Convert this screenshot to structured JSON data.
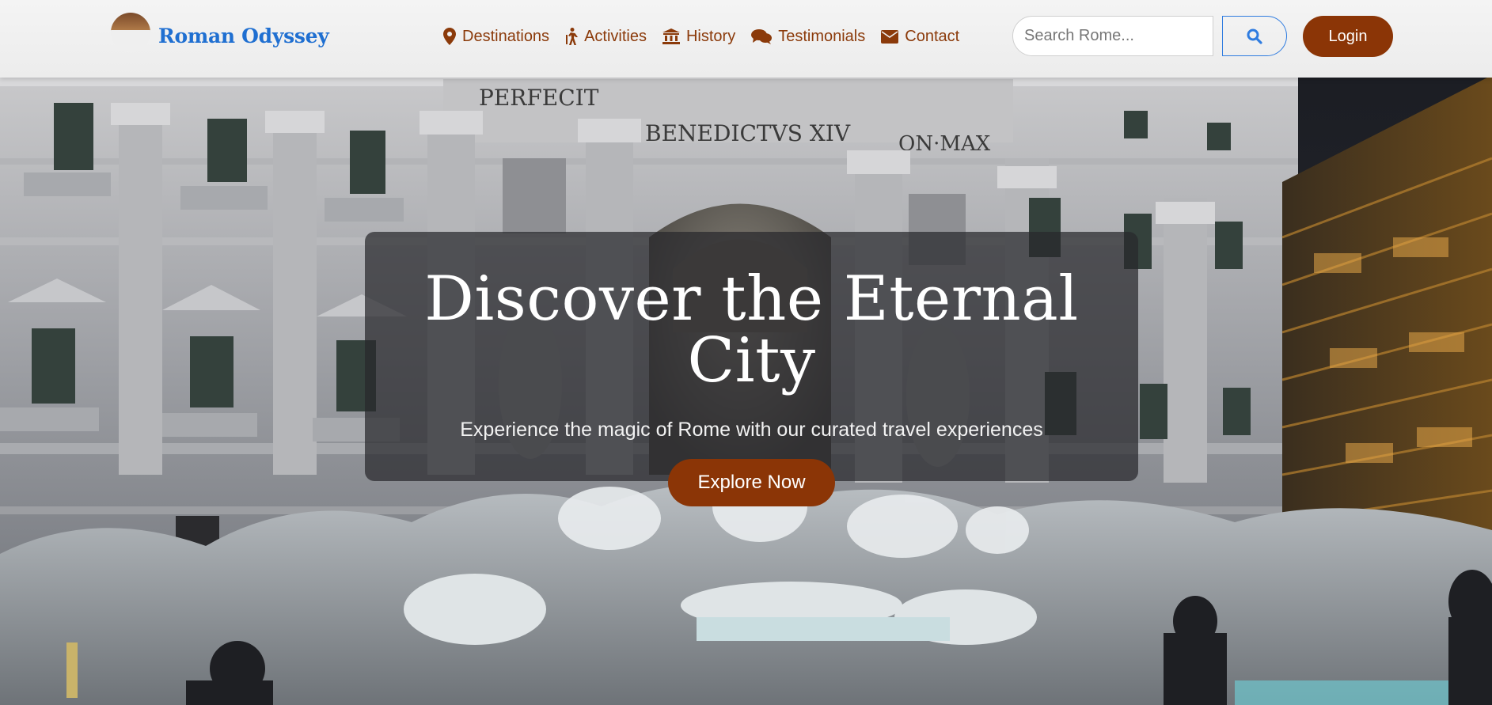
{
  "brand": {
    "name": "Roman Odyssey"
  },
  "nav": {
    "items": [
      {
        "label": "Destinations",
        "icon": "map-pin-icon"
      },
      {
        "label": "Activities",
        "icon": "hiking-icon"
      },
      {
        "label": "History",
        "icon": "landmark-icon"
      },
      {
        "label": "Testimonials",
        "icon": "comments-icon"
      },
      {
        "label": "Contact",
        "icon": "envelope-icon"
      }
    ]
  },
  "search": {
    "placeholder": "Search Rome...",
    "value": "",
    "button_icon": "search-icon"
  },
  "login": {
    "label": "Login"
  },
  "hero": {
    "title": "Discover the Eternal City",
    "subtitle": "Experience the magic of Rome with our curated travel experiences",
    "cta": "Explore Now",
    "inscriptions": [
      "PERFECIT",
      "BENEDICTVS XIV",
      "ON·MAX"
    ]
  },
  "colors": {
    "accent": "#8b3506",
    "brand_blue": "#1f6fd1",
    "nav_text": "#8b3a0a",
    "card_bg": "rgba(40,40,44,0.72)"
  }
}
